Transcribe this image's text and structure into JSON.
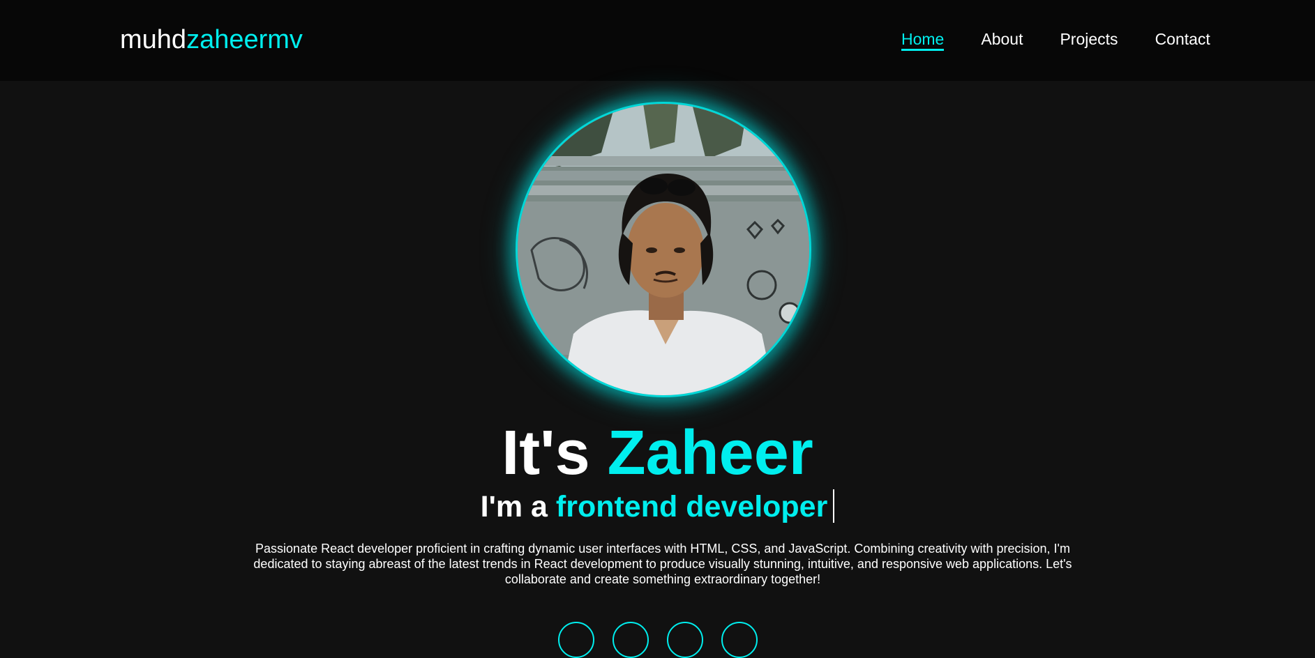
{
  "header": {
    "logo_part1": "muhd",
    "logo_part2": "zaheermv",
    "nav": [
      {
        "label": "Home",
        "active": true
      },
      {
        "label": "About",
        "active": false
      },
      {
        "label": "Projects",
        "active": false
      },
      {
        "label": "Contact",
        "active": false
      }
    ]
  },
  "hero": {
    "title_part1": "It's ",
    "title_part2": "Zaheer",
    "subtitle_part1": "I'm a ",
    "subtitle_part2": "frontend developer",
    "description": "Passionate React developer proficient in crafting dynamic user interfaces with HTML, CSS, and JavaScript. Combining creativity with precision, I'm dedicated to staying abreast of the latest trends in React development to produce visually stunning, intuitive, and responsive web applications. Let's collaborate and create something extraordinary together!",
    "avatar_icon": "profile-photo",
    "socials": [
      "social-icon",
      "social-icon",
      "social-icon",
      "social-icon"
    ]
  },
  "colors": {
    "accent": "#00eeee",
    "background": "#111111",
    "navbar": "#070707"
  }
}
